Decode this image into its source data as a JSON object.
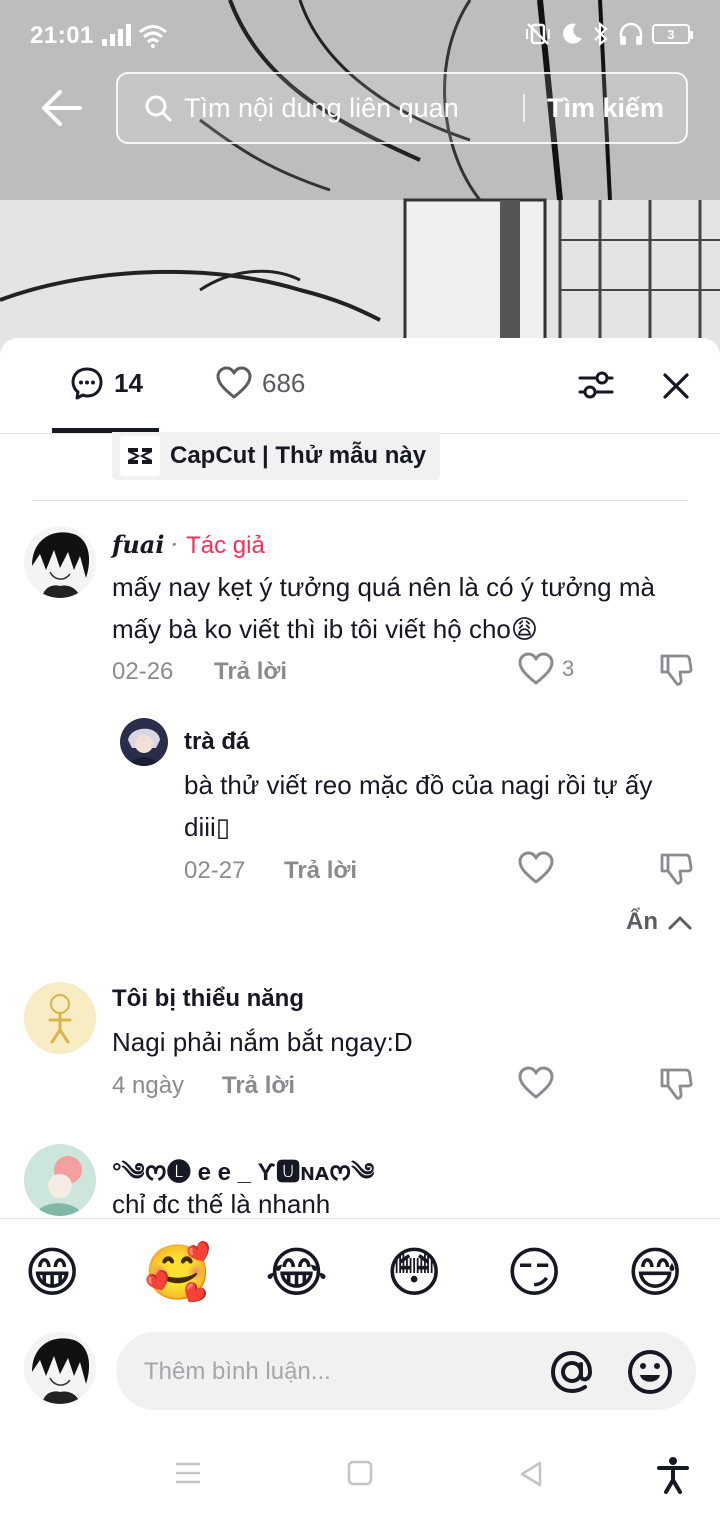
{
  "status_bar": {
    "time": "21:01",
    "battery": "3"
  },
  "search": {
    "placeholder": "Tìm nội dung liên quan",
    "button_label": "Tìm kiếm"
  },
  "tabs": {
    "comment_count": "14",
    "like_count": "686"
  },
  "capcut": {
    "label": "CapCut | Thử mẫu này"
  },
  "comments": [
    {
      "username": "fuai",
      "separator": "·",
      "author_tag": "Tác giả",
      "text": "mấy nay kẹt ý tưởng quá nên là có ý tưởng mà mấy bà ko viết thì ib tôi viết hộ cho😩",
      "date": "02-26",
      "reply_label": "Trả lời",
      "likes": "3"
    },
    {
      "username": "trà đá",
      "text": "bà thử viết reo mặc đồ của nagi rồi tự ấy diii▯",
      "date": "02-27",
      "reply_label": "Trả lời"
    },
    {
      "username": "Tôi bị thiểu năng",
      "text": "Nagi phải nắm bắt ngay:D",
      "date": "4 ngày",
      "reply_label": "Trả lời"
    },
    {
      "username": "°༄ᰔ🅛 e  e _ Ƴ🆄ɴᴀᰔ༄",
      "text": "chỉ đc thế là nhanh"
    }
  ],
  "hide_replies_label": "Ẩn",
  "emoji_bar": [
    "😁",
    "🥰",
    "😂",
    "😳",
    "😏",
    "😅"
  ],
  "input": {
    "placeholder": "Thêm bình luận..."
  }
}
